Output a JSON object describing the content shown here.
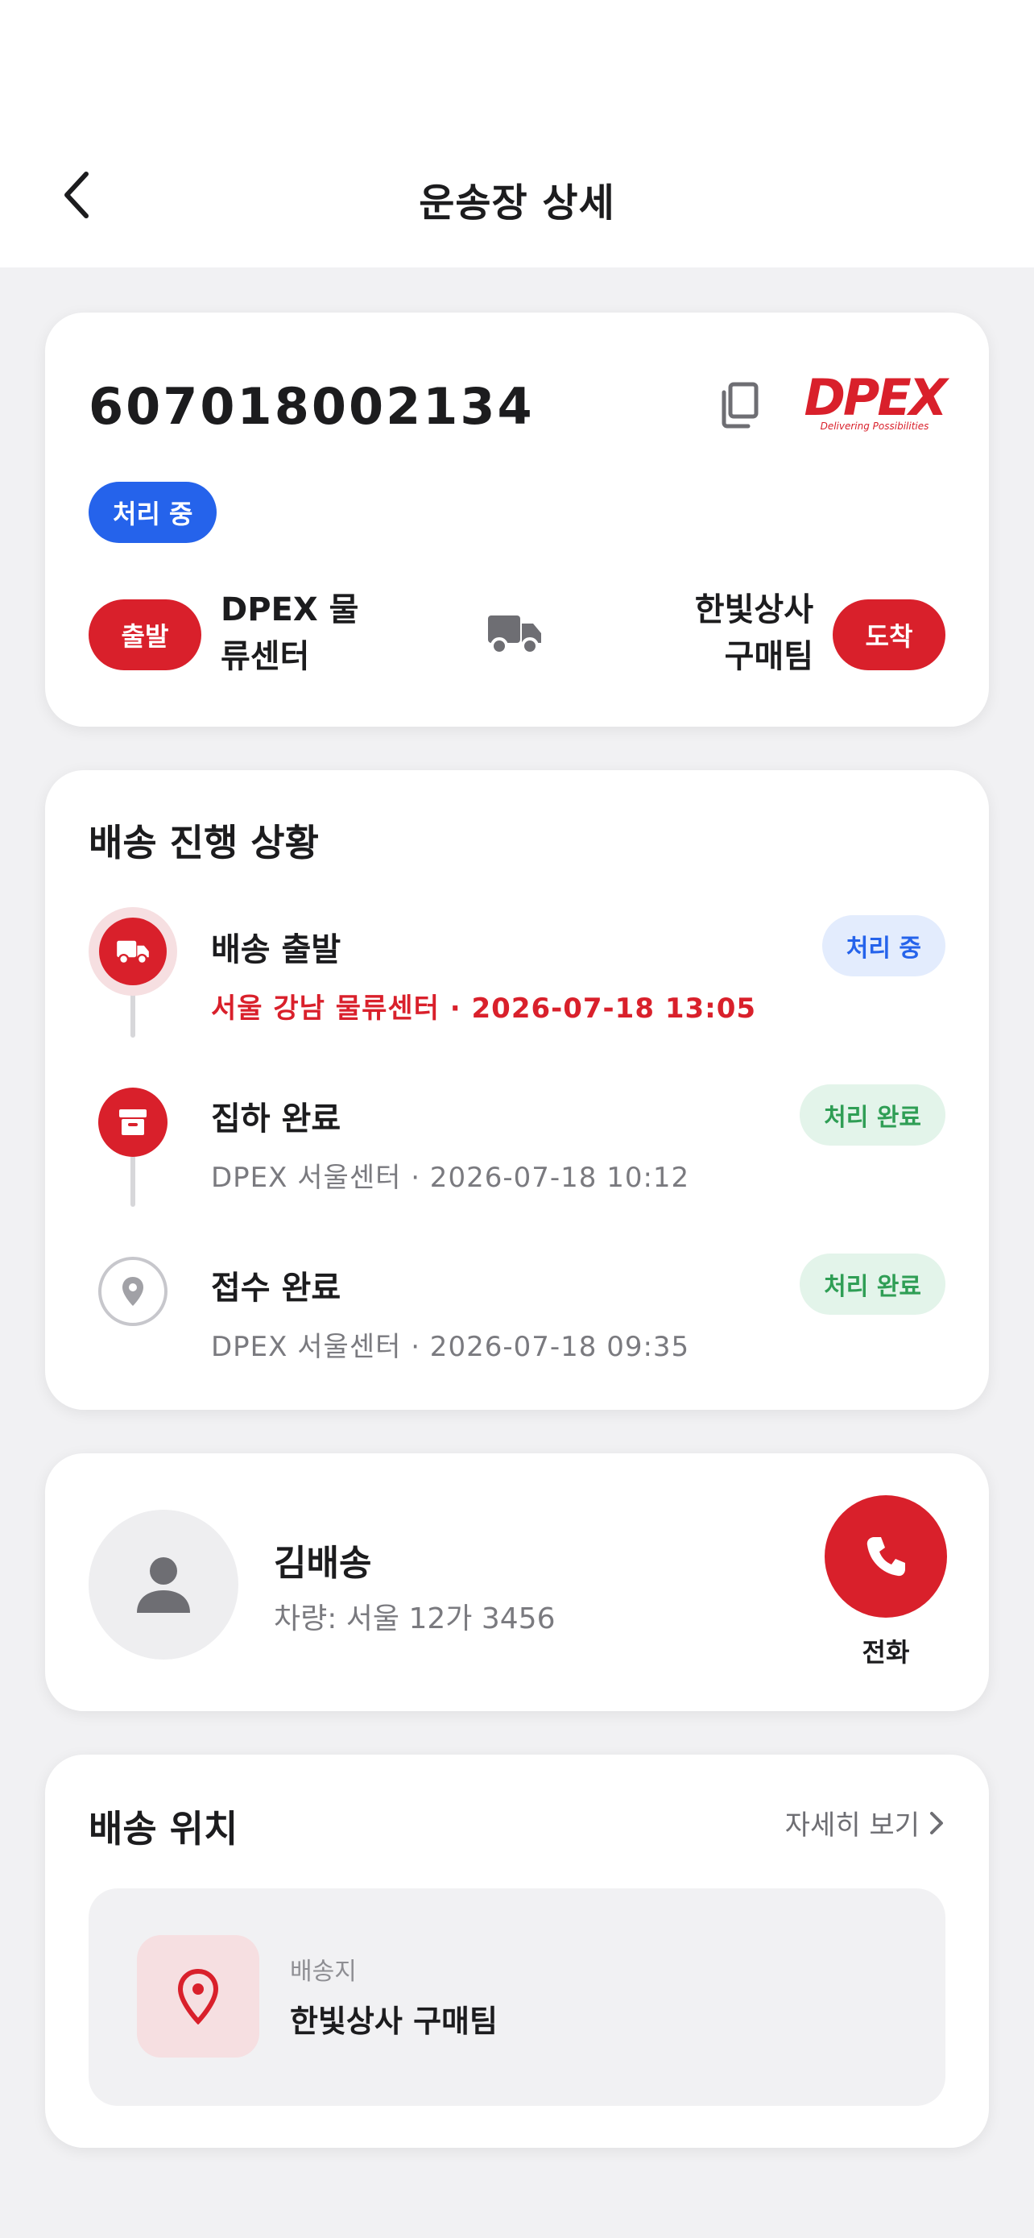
{
  "header": {
    "title": "운송장 상세"
  },
  "shipment": {
    "tracking_number": "607018002134",
    "status": "처리 중",
    "carrier": {
      "logo_text": "DPEX",
      "logo_tagline": "Delivering Possibilities"
    },
    "departure": {
      "badge": "출발",
      "name_line1": "DPEX 물",
      "name_line2": "류센터"
    },
    "arrival": {
      "badge": "도착",
      "name_line1": "한빛상사",
      "name_line2": "구매팀"
    }
  },
  "progress": {
    "title": "배송 진행 상황",
    "steps": [
      {
        "title": "배송 출발",
        "detail": "서울 강남 물류센터 · 2026-07-18 13:05",
        "status": "처리 중",
        "icon": "truck-icon"
      },
      {
        "title": "집하 완료",
        "detail": "DPEX 서울센터 · 2026-07-18 10:12",
        "status": "처리 완료",
        "icon": "box-icon"
      },
      {
        "title": "접수 완료",
        "detail": "DPEX 서울센터 · 2026-07-18 09:35",
        "status": "처리 완료",
        "icon": "pin-icon"
      }
    ]
  },
  "driver": {
    "name": "김배송",
    "vehicle": "차량: 서울 12가 3456",
    "call_label": "전화"
  },
  "location": {
    "title": "배송 위치",
    "more_label": "자세히 보기",
    "dest_label": "배송지",
    "dest_name": "한빛상사 구매팀"
  },
  "colors": {
    "brand_red": "#d9202b",
    "status_blue": "#2563eb",
    "status_green": "#2f9e55"
  }
}
